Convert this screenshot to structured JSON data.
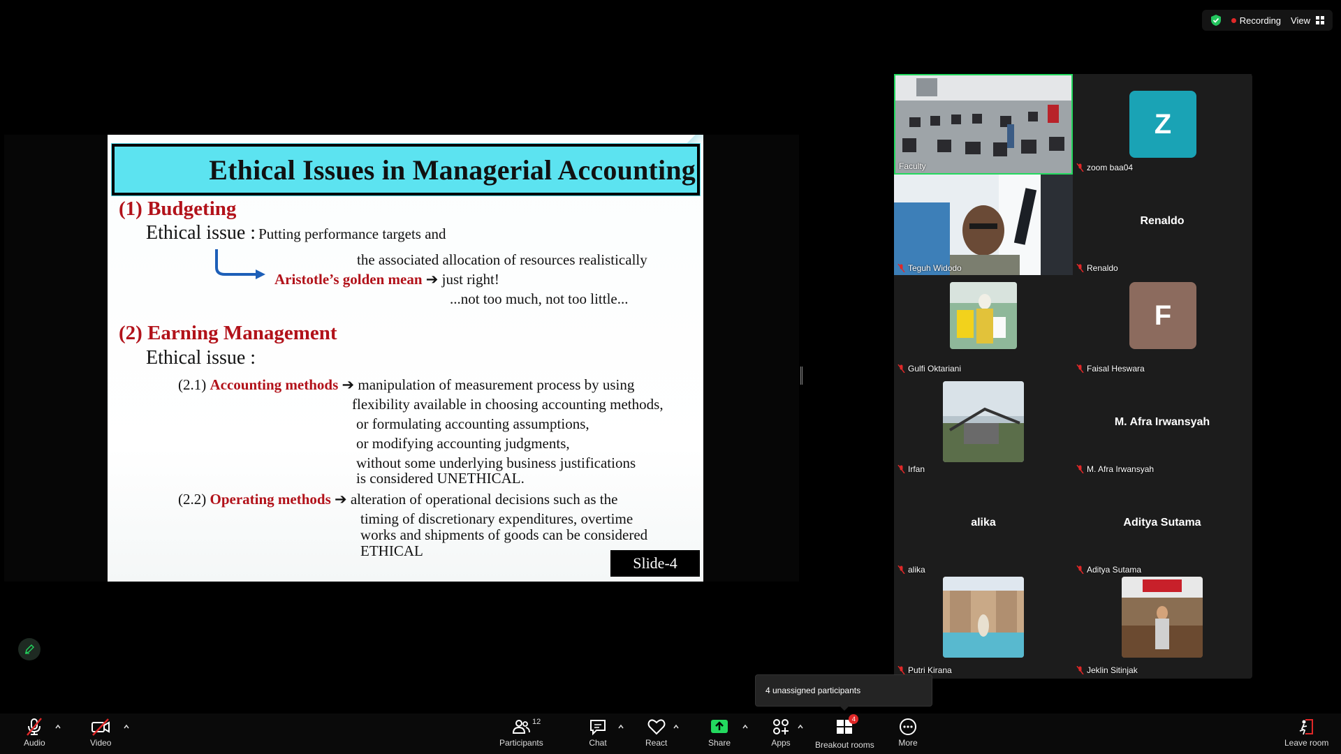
{
  "status": {
    "recording": "Recording",
    "view": "View"
  },
  "slide": {
    "title": "Ethical Issues in Managerial Accounting",
    "s1_heading": "(1) Budgeting",
    "s1_issue_label": "Ethical issue :",
    "s1_issue_text": "Putting performance targets and",
    "s1_line2": "the associated allocation of resources realistically",
    "s1_golden": "Aristotle’s  golden mean",
    "s1_golden_tail": "just right!",
    "s1_line4": "...not too much, not too little...",
    "s2_heading": "(2) Earning Management",
    "s2_issue_label": "Ethical issue :",
    "s21_num": "(2.1)",
    "s21_label": "Accounting methods",
    "s21_text1": "manipulation of measurement process by using",
    "s21_text2": "flexibility available in choosing accounting methods,",
    "s21_text3": "or formulating accounting assumptions,",
    "s21_text4": "or modifying accounting judgments,",
    "s21_text5": "without some underlying business justifications",
    "s21_text6": "is considered UNETHICAL.",
    "s22_num": "(2.2)",
    "s22_label": "Operating methods",
    "s22_text1": "alteration of operational decisions such as the",
    "s22_text2": "timing of discretionary expenditures, overtime",
    "s22_text3": "works and shipments of goods can be considered",
    "s22_text4": "ETHICAL",
    "slide_number": "Slide-4"
  },
  "participants": [
    {
      "name": "Faculty",
      "type": "video-classroom",
      "muted": false,
      "active": true
    },
    {
      "name": "zoom baa04",
      "type": "letter",
      "letter": "Z",
      "color": "#1aa3b5",
      "muted": true
    },
    {
      "name": "Teguh Widodo",
      "type": "video-person",
      "muted": true
    },
    {
      "name": "Renaldo",
      "type": "name",
      "center": "Renaldo",
      "muted": true
    },
    {
      "name": "Gulfi Oktariani",
      "type": "photo",
      "muted": true
    },
    {
      "name": "Faisal Heswara",
      "type": "letter",
      "letter": "F",
      "color": "#8c6b5e",
      "muted": true
    },
    {
      "name": "Irfan",
      "type": "photo",
      "muted": true
    },
    {
      "name": "M. Afra Irwansyah",
      "type": "name",
      "center": "M. Afra Irwansyah",
      "muted": true
    },
    {
      "name": "alika",
      "type": "name",
      "center": "alika",
      "muted": true
    },
    {
      "name": "Aditya Sutama",
      "type": "name",
      "center": "Aditya Sutama",
      "muted": true
    },
    {
      "name": "Putri Kirana",
      "type": "photo",
      "muted": true
    },
    {
      "name": "Jeklin Sitinjak",
      "type": "photo",
      "muted": true
    }
  ],
  "popup": {
    "text": "4 unassigned participants"
  },
  "toolbar": {
    "audio": "Audio",
    "video": "Video",
    "participants": "Participants",
    "participants_count": "12",
    "chat": "Chat",
    "react": "React",
    "share": "Share",
    "apps": "Apps",
    "breakout": "Breakout rooms",
    "breakout_badge": "4",
    "more": "More",
    "leave": "Leave room"
  },
  "colors": {
    "accent_green": "#23d95f",
    "slide_title_bg": "#5ce3f0",
    "slide_red": "#b2121a",
    "rec_red": "#e02828"
  }
}
